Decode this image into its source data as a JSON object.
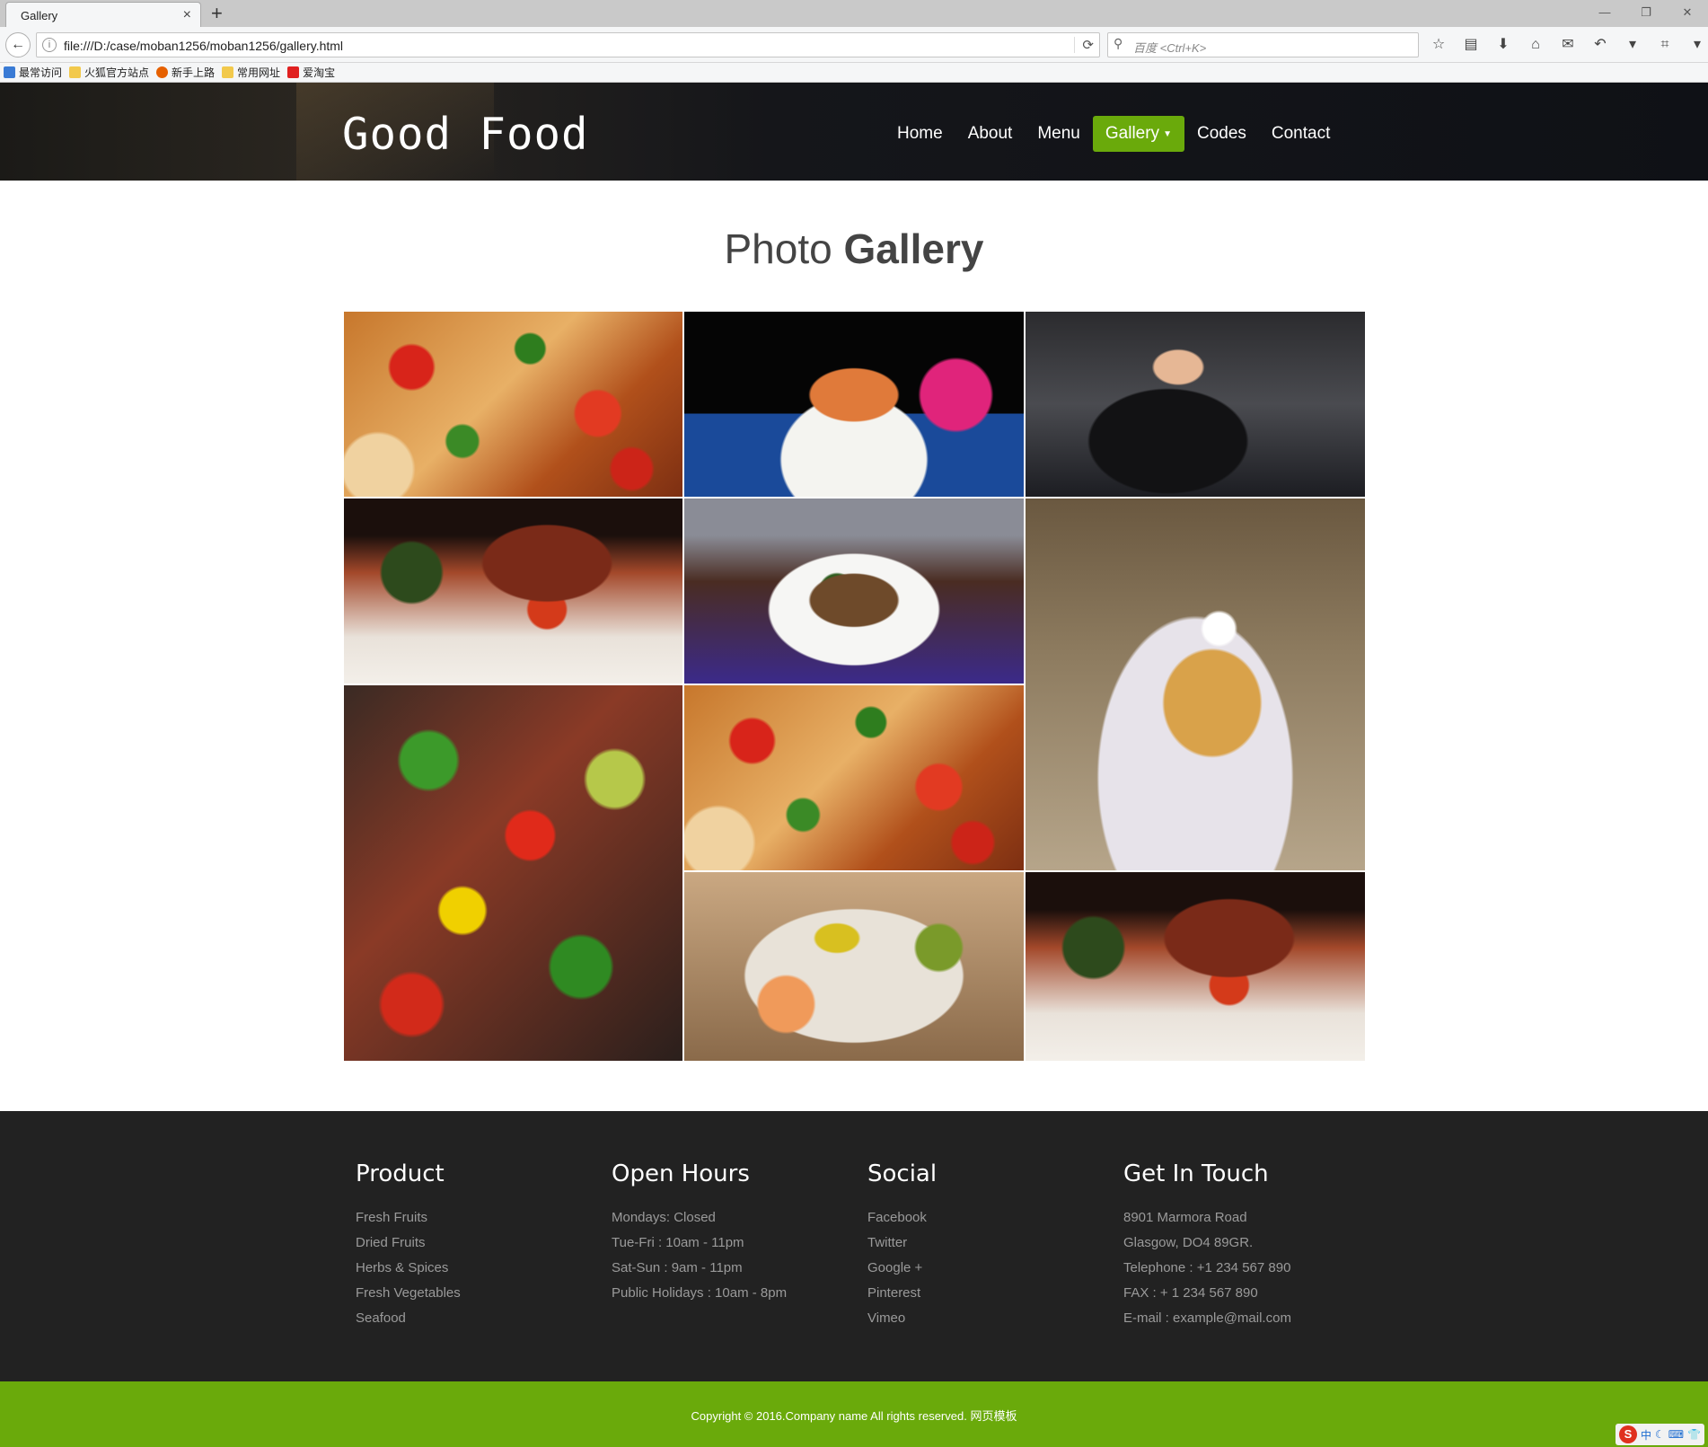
{
  "browser": {
    "tab_title": "Gallery",
    "url": "file:///D:/case/moban1256/moban1256/gallery.html",
    "search_placeholder": "百度 <Ctrl+K>",
    "bookmarks": [
      {
        "label": "最常访问",
        "icon": "blue-page-icon",
        "color": "#3a7bd5"
      },
      {
        "label": "火狐官方站点",
        "icon": "folder-icon",
        "color": "#f2c94c"
      },
      {
        "label": "新手上路",
        "icon": "firefox-icon",
        "color": "#e66000"
      },
      {
        "label": "常用网址",
        "icon": "folder-icon",
        "color": "#f2c94c"
      },
      {
        "label": "爱淘宝",
        "icon": "taobao-icon",
        "color": "#e02020"
      }
    ]
  },
  "site": {
    "logo": "Good Food",
    "nav": [
      {
        "label": "Home",
        "active": false
      },
      {
        "label": "About",
        "active": false
      },
      {
        "label": "Menu",
        "active": false
      },
      {
        "label": "Gallery",
        "active": true
      },
      {
        "label": "Codes",
        "active": false
      },
      {
        "label": "Contact",
        "active": false
      }
    ],
    "accent_color": "#6aaa0b"
  },
  "gallery": {
    "title_light": "Photo",
    "title_bold": "Gallery",
    "photos": [
      {
        "subject": "tofu-with-chili"
      },
      {
        "subject": "shrimp-cocktail"
      },
      {
        "subject": "person-at-table"
      },
      {
        "subject": "teriyaki-chicken"
      },
      {
        "subject": "stir-fry"
      },
      {
        "subject": "cake-roll"
      },
      {
        "subject": "vegetable-kebabs"
      },
      {
        "subject": "tofu-with-chili"
      },
      {
        "subject": "sushi-bowl"
      },
      {
        "subject": "teriyaki-chicken"
      }
    ]
  },
  "footer": {
    "columns": [
      {
        "heading": "Product",
        "items": [
          "Fresh Fruits",
          "Dried Fruits",
          "Herbs & Spices",
          "Fresh Vegetables",
          "Seafood"
        ]
      },
      {
        "heading": "Open Hours",
        "items": [
          "Mondays: Closed",
          "Tue-Fri : 10am - 11pm",
          "Sat-Sun : 9am - 11pm",
          "Public Holidays : 10am - 8pm"
        ]
      },
      {
        "heading": "Social",
        "items": [
          "Facebook",
          "Twitter",
          "Google +",
          "Pinterest",
          "Vimeo"
        ]
      },
      {
        "heading": "Get In Touch",
        "items": [
          "8901 Marmora Road",
          "Glasgow, DO4 89GR.",
          "Telephone : +1 234 567 890",
          "FAX : + 1 234 567 890",
          "E-mail : example@mail.com"
        ]
      }
    ],
    "copyright": "Copyright © 2016.Company name All rights reserved. 网页模板"
  },
  "tray": {
    "ime_mode": "中"
  }
}
